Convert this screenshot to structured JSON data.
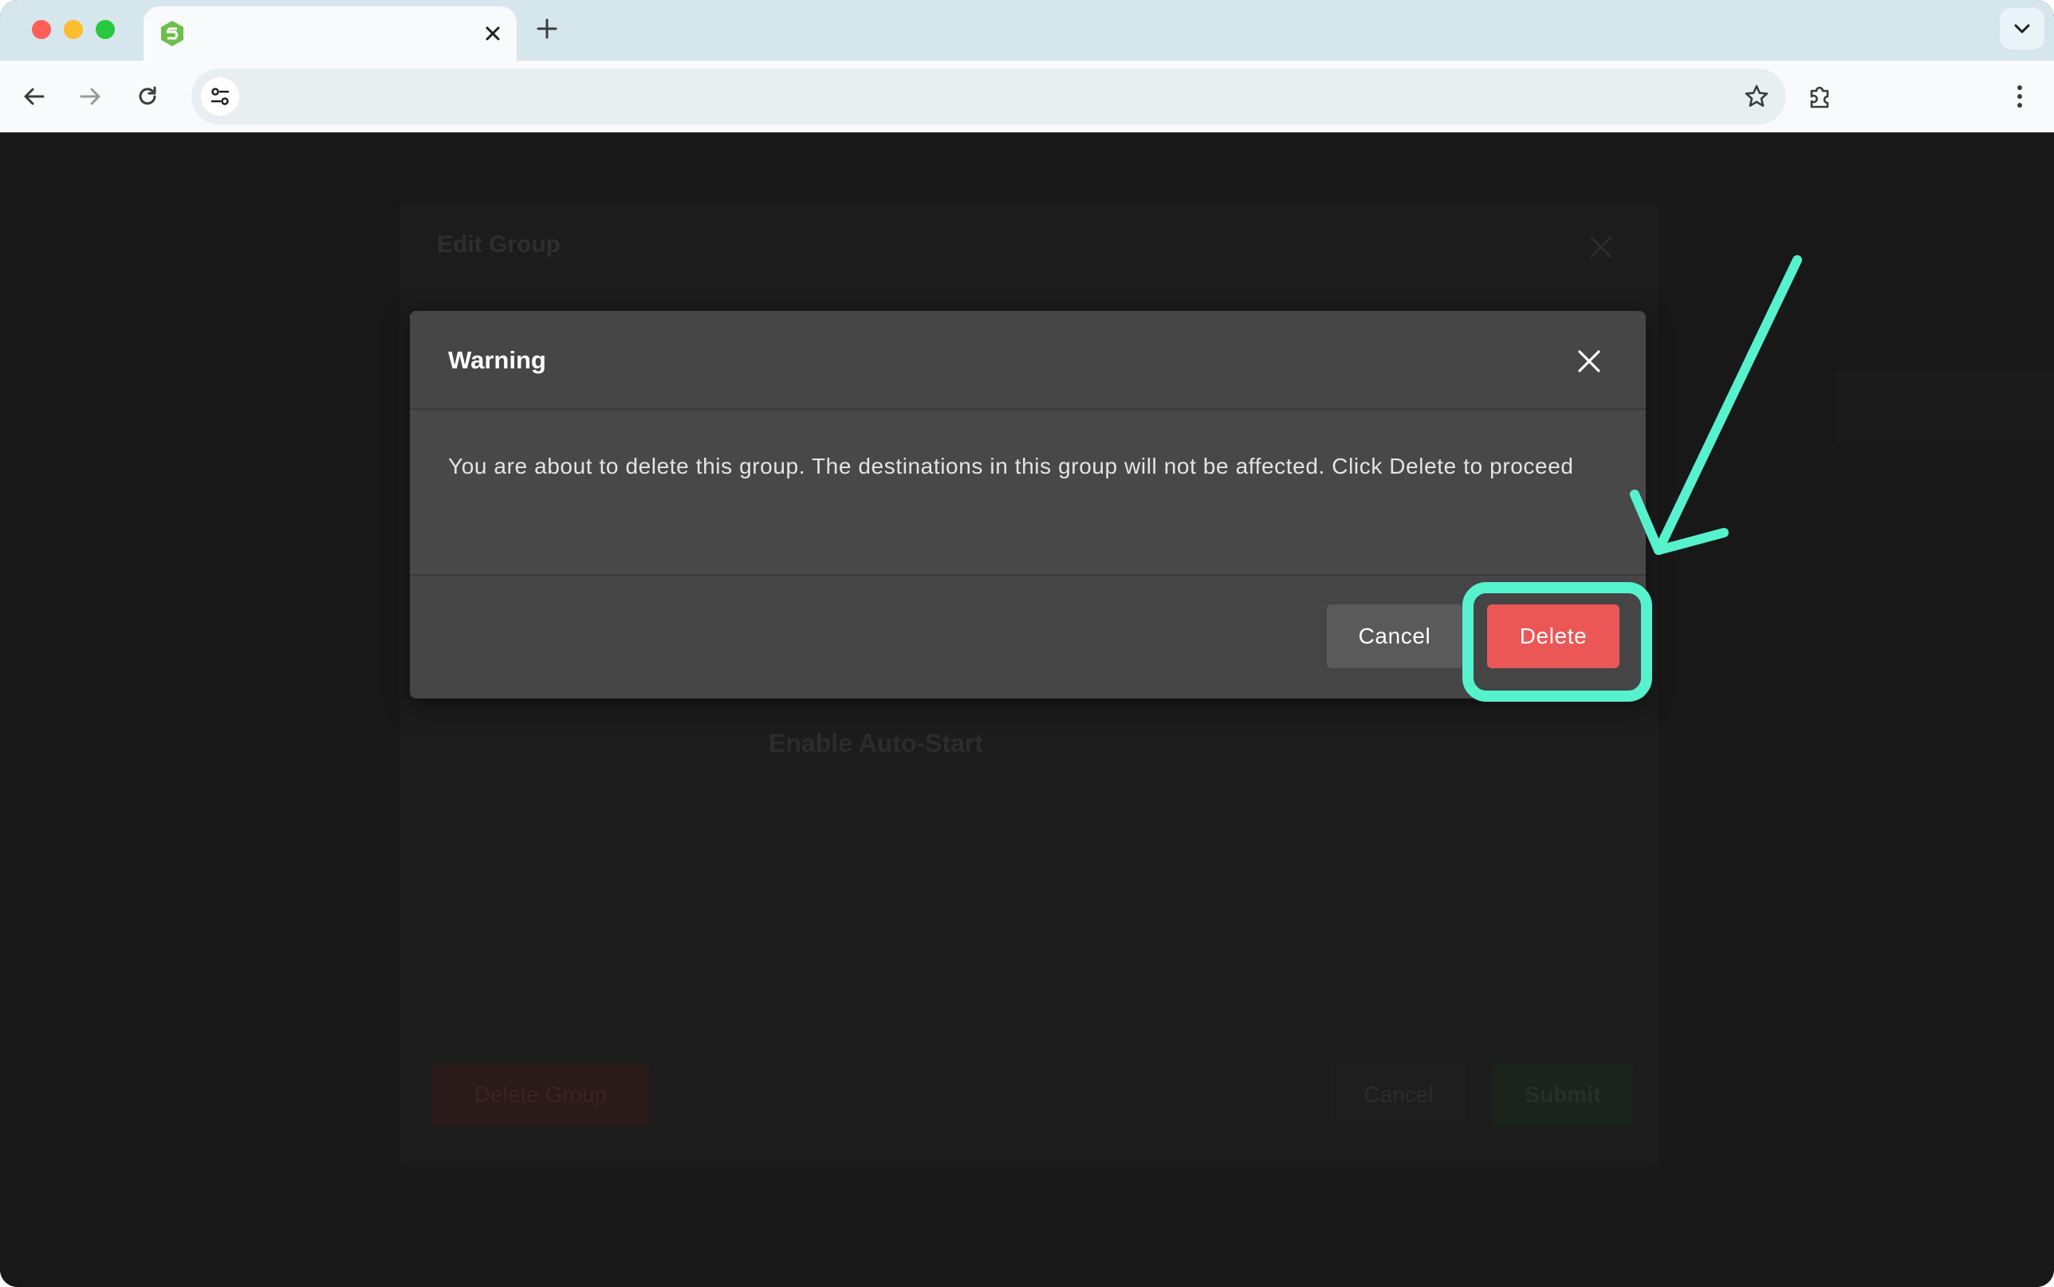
{
  "browser": {
    "tab": {
      "title": "",
      "favicon": "hexagon-s-logo-icon",
      "close_icon": "close-icon"
    },
    "new_tab_icon": "plus-icon",
    "tabs_dropdown_icon": "chevron-down-icon",
    "toolbar": {
      "back_icon": "arrow-left-icon",
      "forward_icon": "arrow-right-icon",
      "reload_icon": "reload-icon",
      "site_info_icon": "tune-icon",
      "address": "",
      "bookmark_icon": "star-icon",
      "extensions_icon": "puzzle-icon",
      "menu_icon": "kebab-menu-icon"
    }
  },
  "background_modal": {
    "title": "Edit Group",
    "auto_start_label": "Enable Auto-Start",
    "delete_group_label": "Delete Group",
    "cancel_label": "Cancel",
    "submit_label": "Submit"
  },
  "dialog": {
    "title": "Warning",
    "message": "You are about to delete this group. The destinations in this group will not be affected. Click Delete to proceed",
    "cancel_label": "Cancel",
    "delete_label": "Delete"
  },
  "colors": {
    "delete_button": "#eb5757",
    "annotation": "#55f2cd",
    "dialog_background": "#474747",
    "overlay": "#181818"
  }
}
